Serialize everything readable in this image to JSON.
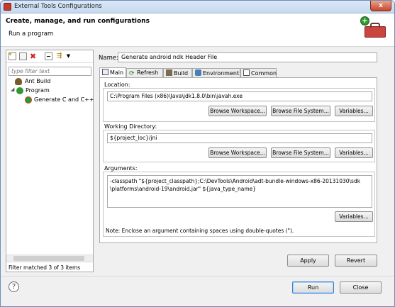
{
  "window": {
    "title": "External Tools Configurations",
    "close_label": "x"
  },
  "header": {
    "title": "Create, manage, and run configurations",
    "subtitle": "Run a program"
  },
  "sidebar": {
    "filter_placeholder": "type filter text",
    "tree": [
      {
        "label": "Ant Build",
        "icon": "ant-icon"
      },
      {
        "label": "Program",
        "icon": "program-icon",
        "expanded": true
      },
      {
        "label": "Generate C and C++",
        "icon": "program-config-icon"
      }
    ],
    "status": "Filter matched 3 of 3 items"
  },
  "name": {
    "label": "Name:",
    "value": "Generate android ndk  Header File"
  },
  "tabs": [
    {
      "label": "Main",
      "icon": "main-icon",
      "active": true
    },
    {
      "label": "Refresh",
      "icon": "refresh-icon"
    },
    {
      "label": "Build",
      "icon": "build-icon"
    },
    {
      "label": "Environment",
      "icon": "environment-icon"
    },
    {
      "label": "Common",
      "icon": "common-icon"
    }
  ],
  "location": {
    "label": "Location:",
    "value": "C:\\Program Files (x86)\\Java\\jdk1.8.0\\bin\\javah.exe",
    "browse_workspace": "Browse Workspace...",
    "browse_fs": "Browse File System...",
    "variables": "Variables..."
  },
  "workdir": {
    "label": "Working Directory:",
    "value": "${project_loc}/jni",
    "browse_workspace": "Browse Workspace...",
    "browse_fs": "Browse File System...",
    "variables": "Variables..."
  },
  "arguments": {
    "label": "Arguments:",
    "line1": "-classpath  \"${project_classpath};C:\\DevTools\\Android\\adt-bundle-windows-x86-20131030\\sdk",
    "line2": "\\platforms\\android-19\\android.jar\" ${java_type_name}",
    "variables": "Variables...",
    "note": "Note: Enclose an argument containing spaces using double-quotes (\")."
  },
  "actions": {
    "apply": "Apply",
    "revert": "Revert",
    "run": "Run",
    "close": "Close"
  },
  "help": {
    "label": "?"
  }
}
